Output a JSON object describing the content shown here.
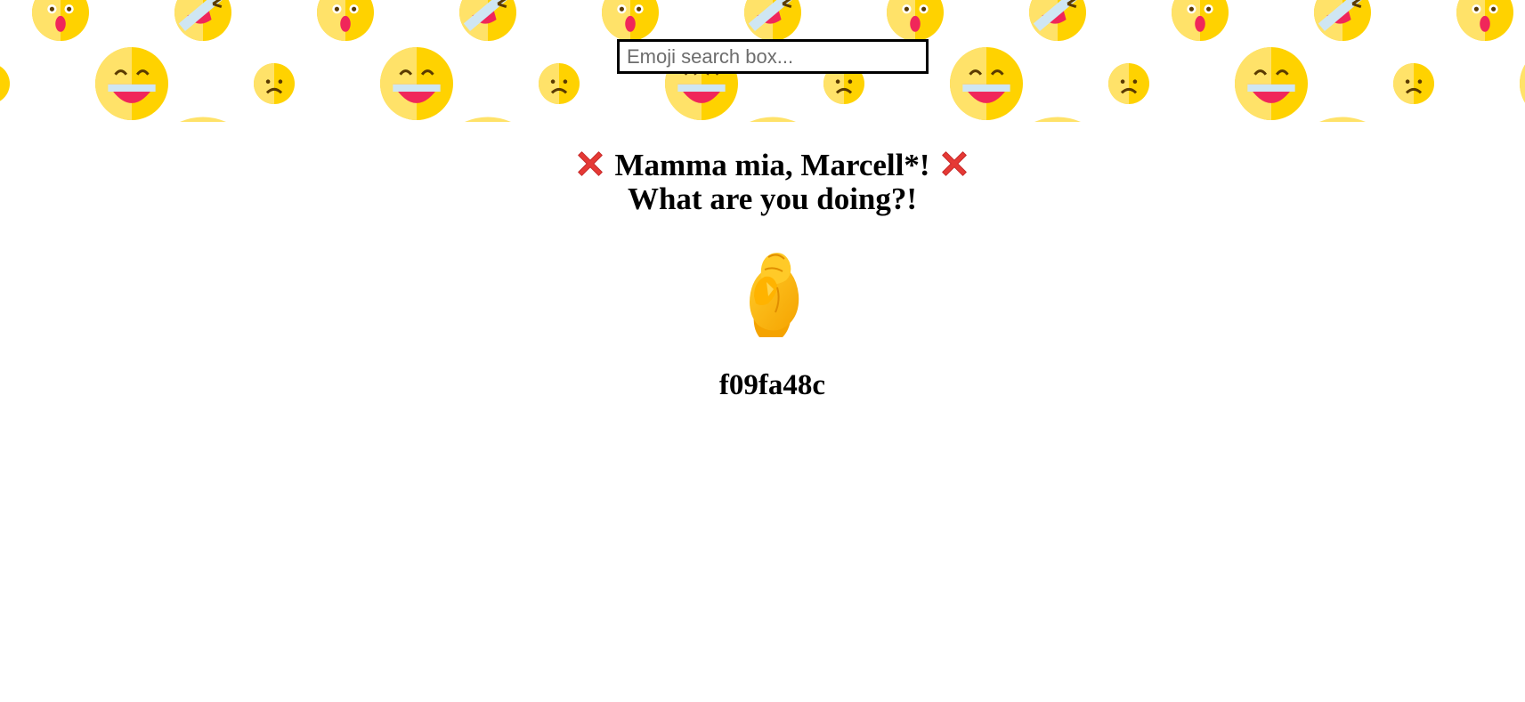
{
  "search": {
    "placeholder": "Emoji search box...",
    "value": ""
  },
  "message": {
    "line1": "Mamma mia, Marcell*!",
    "line2": "What are you doing?!",
    "marker_icon": "cross-mark-icon"
  },
  "result": {
    "emoji_icon": "pinched-fingers-icon",
    "code": "f09fa48c"
  },
  "banner": {
    "pattern_icons": [
      "astonished-face-icon",
      "face-with-bandage-icon",
      "grinning-face-icon",
      "frowning-face-icon"
    ]
  },
  "colors": {
    "emoji_yellow": "#FFD200",
    "emoji_light": "#FFE269",
    "mouth_red": "#F0265A",
    "cross_red": "#E53935"
  }
}
